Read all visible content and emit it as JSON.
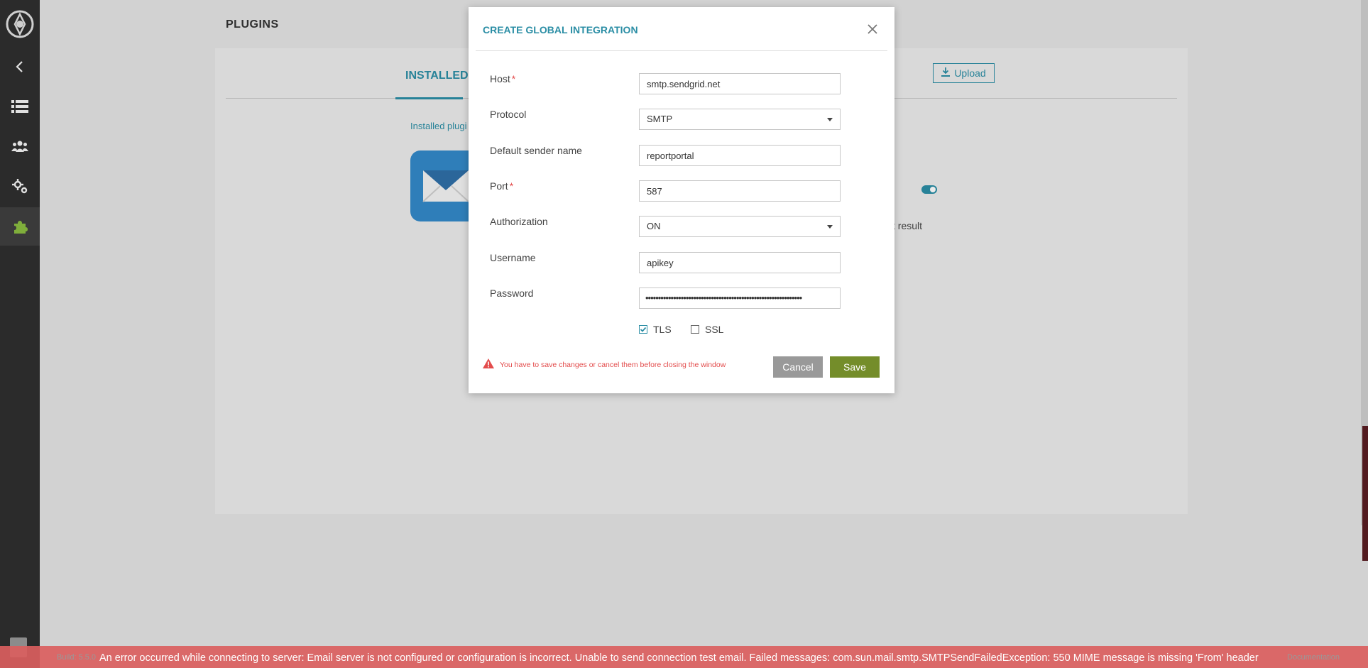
{
  "page": {
    "title": "PLUGINS",
    "tab_installed": "INSTALLED",
    "upload_label": "Upload",
    "installed_label": "Installed plugi",
    "bg_result_text": "st result"
  },
  "modal": {
    "title": "CREATE GLOBAL INTEGRATION",
    "fields": {
      "host": {
        "label": "Host",
        "required": "*",
        "value": "smtp.sendgrid.net"
      },
      "protocol": {
        "label": "Protocol",
        "value": "SMTP"
      },
      "sender": {
        "label": "Default sender name",
        "value": "reportportal"
      },
      "port": {
        "label": "Port",
        "required": "*",
        "value": "587"
      },
      "authorization": {
        "label": "Authorization",
        "value": "ON"
      },
      "username": {
        "label": "Username",
        "value": "apikey"
      },
      "password": {
        "label": "Password",
        "value": "••••••••••••••••••••••••••••••••••••••••••••••••••••••••••••••"
      }
    },
    "tls": {
      "label": "TLS",
      "checked": true
    },
    "ssl": {
      "label": "SSL",
      "checked": false
    },
    "warning": "You have to save changes or cancel them before closing the window",
    "cancel_label": "Cancel",
    "save_label": "Save"
  },
  "footer": {
    "build": "Build: 5.5.0",
    "documentation": "Documentation"
  },
  "error_bar": {
    "message": "An error occurred while connecting to server: Email server is not configured or configuration is incorrect. Unable to send connection test email. Failed messages: com.sun.mail.smtp.SMTPSendFailedException: 550 MIME message is missing 'From' header"
  },
  "colors": {
    "accent": "#2b8ea5",
    "save": "#748d2a",
    "error": "#e34c4c",
    "sidebar": "#2b2b2b"
  },
  "icons": [
    "logo-icon",
    "back-arrow-icon",
    "launches-list-icon",
    "members-icon",
    "settings-icon",
    "plugins-puzzle-icon",
    "upload-icon",
    "email-plugin-icon",
    "close-icon",
    "warning-icon",
    "checkmark-icon"
  ]
}
